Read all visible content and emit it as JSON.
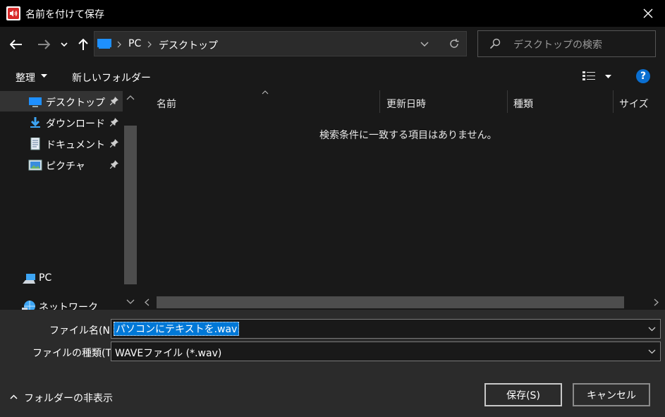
{
  "window": {
    "title": "名前を付けて保存"
  },
  "nav": {
    "breadcrumb": [
      "PC",
      "デスクトップ"
    ],
    "search_placeholder": "デスクトップの検索"
  },
  "toolbar": {
    "organize_label": "整理",
    "new_folder_label": "新しいフォルダー"
  },
  "sidebar": {
    "quick_access": [
      {
        "label": "デスクトップ",
        "icon": "desktop-icon",
        "pinned": true
      },
      {
        "label": "ダウンロード",
        "icon": "download-icon",
        "pinned": true
      },
      {
        "label": "ドキュメント",
        "icon": "document-icon",
        "pinned": true
      },
      {
        "label": "ピクチャ",
        "icon": "picture-icon",
        "pinned": true
      }
    ],
    "pc_label": "PC",
    "network_label": "ネットワーク"
  },
  "filelist": {
    "columns": [
      "名前",
      "更新日時",
      "種類",
      "サイズ"
    ],
    "empty_message": "検索条件に一致する項目はありません。"
  },
  "form": {
    "filename_label": "ファイル名(N):",
    "filename_value": "パソコンにテキストを.wav",
    "filetype_label": "ファイルの種類(T):",
    "filetype_value": "WAVEファイル (*.wav)"
  },
  "footer": {
    "hide_folders_label": "フォルダーの非表示",
    "save_label": "保存(S)",
    "cancel_label": "キャンセル"
  },
  "colors": {
    "accent": "#0078d7",
    "background": "#191919",
    "panel": "#2b2b2b",
    "title_bar": "#000000"
  }
}
